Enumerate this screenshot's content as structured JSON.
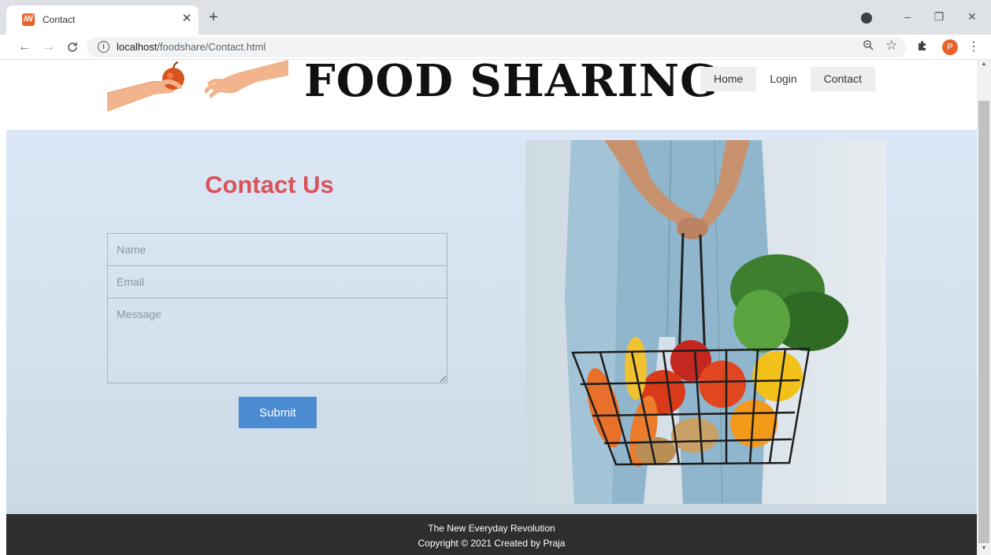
{
  "browser": {
    "tab_title": "Contact",
    "tab_favicon": "xampp-favicon-icon",
    "tab_close": "✕",
    "new_tab": "+",
    "url_host": "localhost",
    "url_path": "/foodshare/Contact.html",
    "profile_initial": "P",
    "window_controls": {
      "minimize": "–",
      "restore": "❐",
      "close": "✕"
    },
    "nav": {
      "back": "←",
      "forward": "→",
      "reload": "C"
    },
    "icons": {
      "info": "i",
      "zoom": "⚲",
      "star": "☆",
      "extensions": "✱",
      "menu": "⋮"
    }
  },
  "header": {
    "site_title": "FOOD SHARING",
    "nav_items": [
      {
        "label": "Home"
      },
      {
        "label": "Login"
      },
      {
        "label": "Contact"
      }
    ]
  },
  "contact": {
    "title": "Contact Us",
    "name_placeholder": "Name",
    "email_placeholder": "Email",
    "message_placeholder": "Message",
    "submit_label": "Submit"
  },
  "footer": {
    "line1": "The New Everyday Revolution",
    "line2": "Copyright © 2021 Created by Praja"
  },
  "colors": {
    "accent_title": "#d9535a",
    "submit_bg": "#4a8bd1",
    "footer_bg": "#2e2e2e",
    "hero_bg": "#d6e2ef"
  }
}
